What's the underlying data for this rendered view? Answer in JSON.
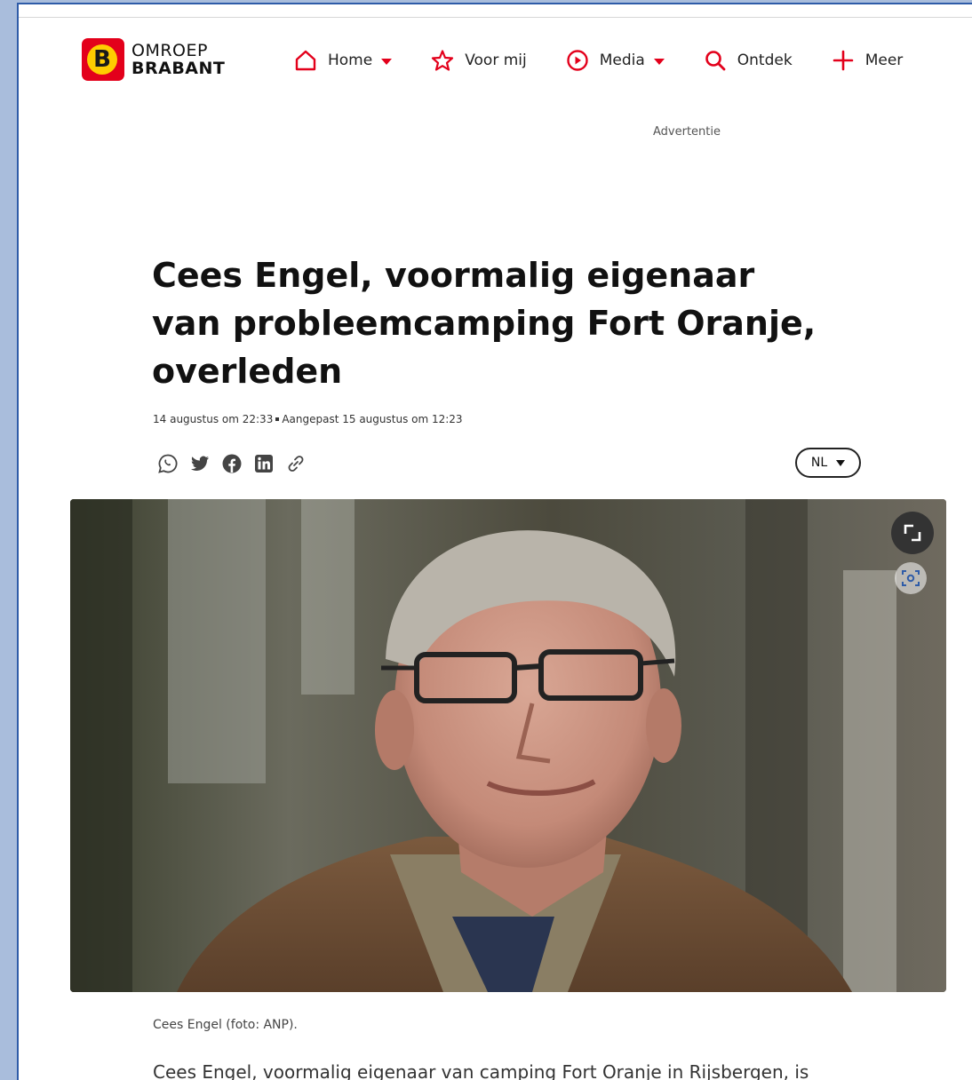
{
  "brand": {
    "line1": "OMROEP",
    "line2": "BRABANT",
    "letter": "B",
    "color_red": "#e3001b",
    "color_yellow": "#ffcc00"
  },
  "nav": {
    "items": [
      {
        "label": "Home",
        "icon": "home-icon",
        "dropdown": true
      },
      {
        "label": "Voor mij",
        "icon": "star-icon",
        "dropdown": false
      },
      {
        "label": "Media",
        "icon": "play-circle-icon",
        "dropdown": true
      },
      {
        "label": "Ontdek",
        "icon": "search-icon",
        "dropdown": false
      },
      {
        "label": "Meer",
        "icon": "plus-icon",
        "dropdown": false
      }
    ]
  },
  "advert_label": "Advertentie",
  "article": {
    "title": "Cees Engel, voormalig eigenaar van probleemcamping Fort Oranje, overleden",
    "published": "14 augustus om 22:33",
    "updated": "Aangepast 15 augustus om 12:23",
    "share_icons": [
      "whatsapp-icon",
      "twitter-icon",
      "facebook-icon",
      "linkedin-icon",
      "link-icon"
    ],
    "language": "NL",
    "caption": "Cees Engel (foto: ANP).",
    "body_first_line": "Cees Engel, voormalig eigenaar van camping Fort Oranje in Rijsbergen, is"
  }
}
